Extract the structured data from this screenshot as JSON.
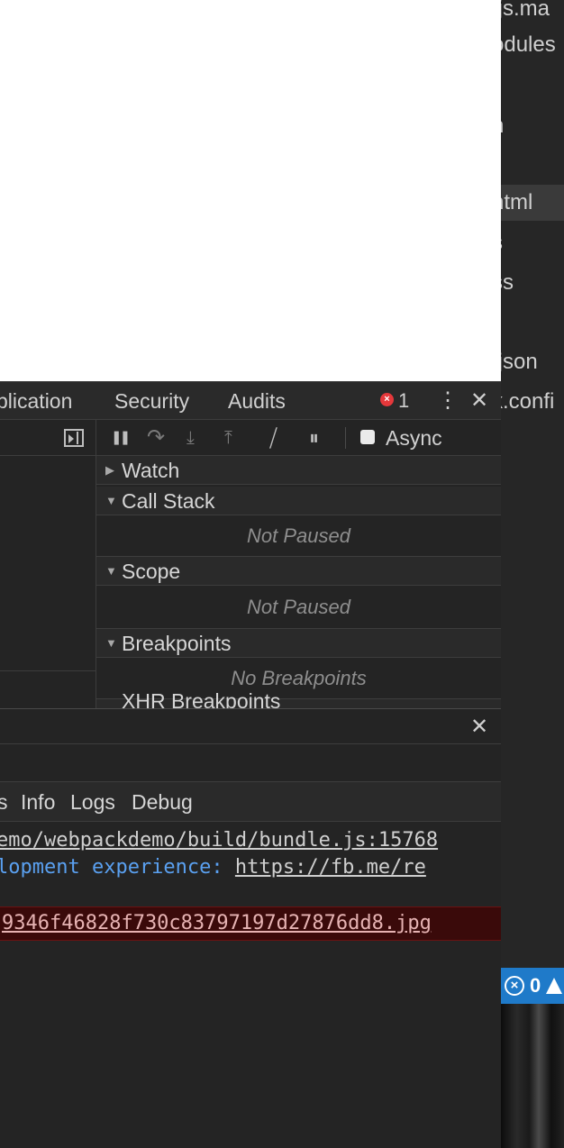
{
  "editor": {
    "files": [
      {
        "label": ".js.ma",
        "active": false
      },
      {
        "label": "odules",
        "active": false
      },
      {
        "label": "n",
        "active": false
      },
      {
        "label": "ntml",
        "active": true
      },
      {
        "label": "s",
        "active": false
      },
      {
        "label": "ss",
        "active": false
      },
      {
        "label": ".json",
        "active": false
      },
      {
        "label": "k.confi",
        "active": false
      }
    ]
  },
  "statusbar": {
    "error_count": "0"
  },
  "devtools": {
    "tabs": [
      "plication",
      "Security",
      "Audits"
    ],
    "error_badge_icon": "×",
    "error_count": "1",
    "menu_icon": "⋮",
    "close_icon": "✕"
  },
  "debugger": {
    "toolbar": {
      "pause_icon": "❚❚",
      "step_over_icon": "↷",
      "step_into_icon": "⤓",
      "step_out_icon": "⤒",
      "deactivate_icon": "⧸",
      "pause_exceptions_icon": "⏸",
      "async_label": "Async"
    },
    "sections": [
      {
        "title": "Watch",
        "expanded": false,
        "body": ""
      },
      {
        "title": "Call Stack",
        "expanded": true,
        "body": "Not Paused"
      },
      {
        "title": "Scope",
        "expanded": true,
        "body": "Not Paused"
      },
      {
        "title": "Breakpoints",
        "expanded": true,
        "body": "No Breakpoints"
      }
    ],
    "cut_off_section": "XHR Breakpoints"
  },
  "console": {
    "close_icon": "✕",
    "levels": [
      "s",
      "Info",
      "Logs",
      "Debug"
    ],
    "lines": {
      "line1_link": "emo/webpackdemo/build/bundle.js:15768",
      "line2_text": "lopment experience:",
      "line2_link": "https://fb.me/re",
      "error_link": "9346f46828f730c83797197d27876dd8.jpg"
    }
  }
}
